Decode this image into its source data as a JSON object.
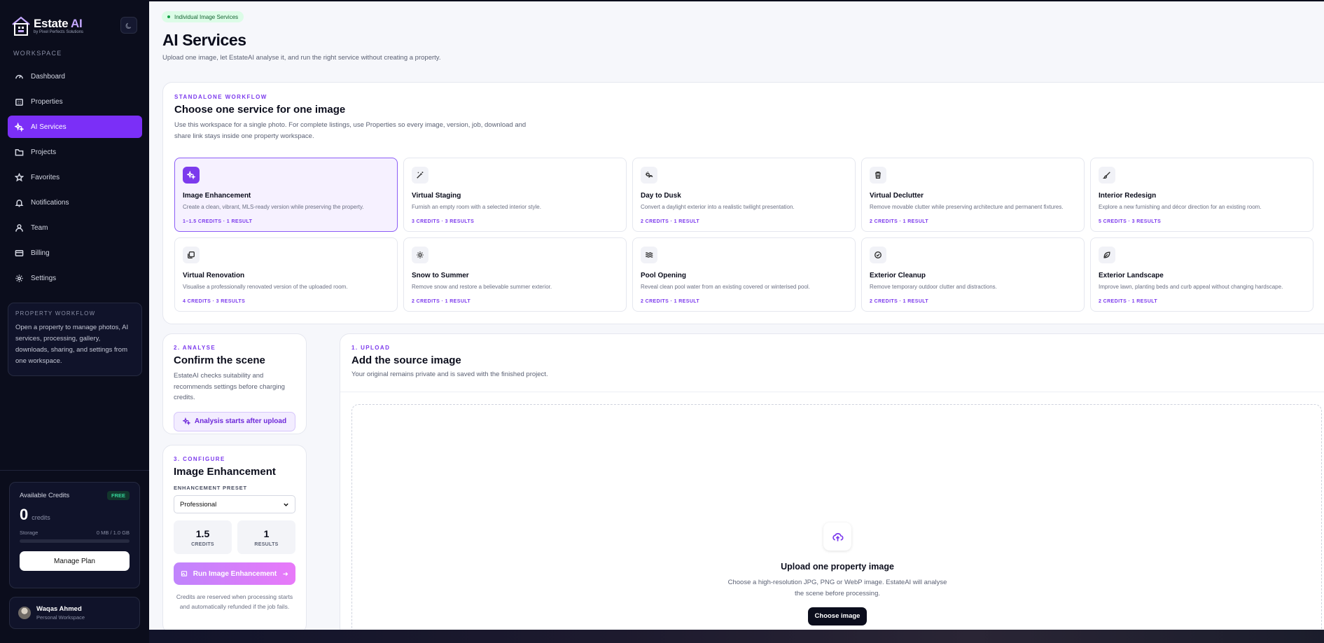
{
  "brand": {
    "name": "Estate",
    "name_accent": "AI",
    "tagline": "by Pixel Perfects Solutions"
  },
  "sidebar": {
    "section_label": "WORKSPACE",
    "items": [
      {
        "label": "Dashboard",
        "icon": "gauge-icon"
      },
      {
        "label": "Properties",
        "icon": "building-icon"
      },
      {
        "label": "AI Services",
        "icon": "sparkles-icon",
        "active": true
      },
      {
        "label": "Projects",
        "icon": "folder-icon"
      },
      {
        "label": "Favorites",
        "icon": "star-icon"
      },
      {
        "label": "Notifications",
        "icon": "bell-icon"
      },
      {
        "label": "Team",
        "icon": "user-icon"
      },
      {
        "label": "Billing",
        "icon": "card-icon"
      },
      {
        "label": "Settings",
        "icon": "gear-icon"
      }
    ],
    "property_workflow": {
      "title": "PROPERTY WORKFLOW",
      "text": "Open a property to manage photos, AI services, processing, gallery, downloads, sharing, and settings from one workspace."
    },
    "credits": {
      "label": "Available Credits",
      "plan_badge": "FREE",
      "amount": "0",
      "unit": "credits",
      "storage_label": "Storage",
      "storage_value": "0 MB / 1.0 GB",
      "storage_used_fraction": 0,
      "manage_label": "Manage Plan"
    },
    "user": {
      "name": "Waqas Ahmed",
      "workspace": "Personal Workspace"
    }
  },
  "header": {
    "pill": "Individual Image Services",
    "title": "AI Services",
    "subtitle": "Upload one image, let EstateAI analyse it, and run the right service without creating a property."
  },
  "standalone": {
    "eyebrow": "STANDALONE WORKFLOW",
    "title": "Choose one service for one image",
    "description": "Use this workspace for a single photo. For complete listings, use Properties so every image, version, job, download and share link stays inside one property workspace.",
    "services": [
      {
        "name": "Image Enhancement",
        "desc": "Create a clean, vibrant, MLS-ready version while preserving the property.",
        "meta": "1–1.5 CREDITS · 1 RESULT",
        "icon": "sparkles-icon",
        "selected": true
      },
      {
        "name": "Virtual Staging",
        "desc": "Furnish an empty room with a selected interior style.",
        "meta": "3 CREDITS · 3 RESULTS",
        "icon": "wand-icon"
      },
      {
        "name": "Day to Dusk",
        "desc": "Convert a daylight exterior into a realistic twilight presentation.",
        "meta": "2 CREDITS · 1 RESULT",
        "icon": "sun-moon-icon"
      },
      {
        "name": "Virtual Declutter",
        "desc": "Remove movable clutter while preserving architecture and permanent fixtures.",
        "meta": "2 CREDITS · 1 RESULT",
        "icon": "trash-icon"
      },
      {
        "name": "Interior Redesign",
        "desc": "Explore a new furnishing and décor direction for an existing room.",
        "meta": "5 CREDITS · 3 RESULTS",
        "icon": "brush-icon"
      },
      {
        "name": "Virtual Renovation",
        "desc": "Visualise a professionally renovated version of the uploaded room.",
        "meta": "4 CREDITS · 3 RESULTS",
        "icon": "layers-icon"
      },
      {
        "name": "Snow to Summer",
        "desc": "Remove snow and restore a believable summer exterior.",
        "meta": "2 CREDITS · 1 RESULT",
        "icon": "sun-icon"
      },
      {
        "name": "Pool Opening",
        "desc": "Reveal clean pool water from an existing covered or winterised pool.",
        "meta": "2 CREDITS · 1 RESULT",
        "icon": "waves-icon"
      },
      {
        "name": "Exterior Cleanup",
        "desc": "Remove temporary outdoor clutter and distractions.",
        "meta": "2 CREDITS · 1 RESULT",
        "icon": "check-circle-icon"
      },
      {
        "name": "Exterior Landscape",
        "desc": "Improve lawn, planting beds and curb appeal without changing hardscape.",
        "meta": "2 CREDITS · 1 RESULT",
        "icon": "leaf-icon"
      }
    ]
  },
  "analyse": {
    "eyebrow": "2. ANALYSE",
    "title": "Confirm the scene",
    "description": "EstateAI checks suitability and recommends settings before charging credits.",
    "button": "Analysis starts after upload"
  },
  "configure": {
    "eyebrow": "3. CONFIGURE",
    "title": "Image Enhancement",
    "preset_label": "ENHANCEMENT PRESET",
    "preset_value": "Professional",
    "credits_value": "1.5",
    "credits_label": "CREDITS",
    "results_value": "1",
    "results_label": "RESULTS",
    "run_button": "Run Image Enhancement",
    "note": "Credits are reserved when processing starts and automatically refunded if the job fails."
  },
  "upload": {
    "eyebrow": "1. UPLOAD",
    "title": "Add the source image",
    "description": "Your original remains private and is saved with the finished project.",
    "dz_title": "Upload one property image",
    "dz_desc": "Choose a high-resolution JPG, PNG or WebP image. EstateAI will analyse the scene before processing.",
    "button": "Choose image"
  },
  "colors": {
    "accent": "#7c3aed",
    "sidebar_bg": "#0b0d1c",
    "active_nav": "#7b2ff7",
    "success": "#16a34a"
  }
}
